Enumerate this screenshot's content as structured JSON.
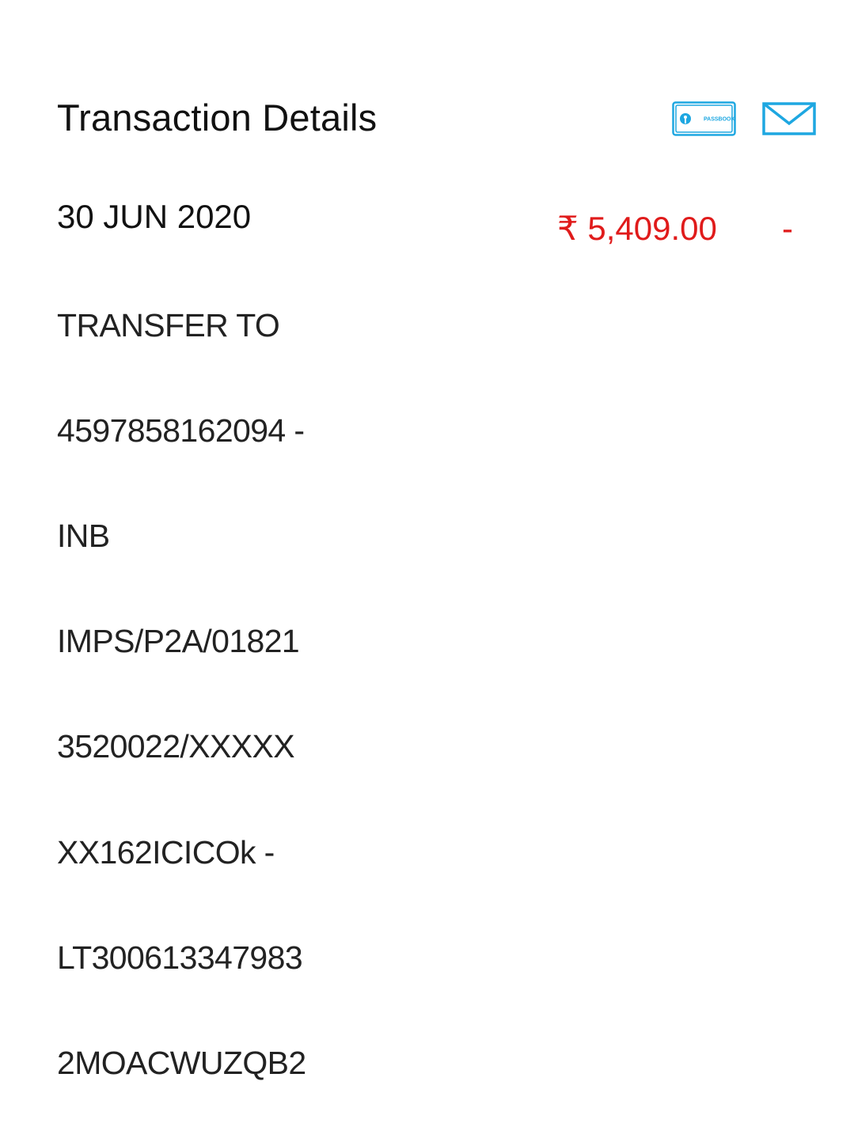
{
  "header": {
    "title": "Transaction Details",
    "passbook_icon_text": "PASSBOOK"
  },
  "transaction": {
    "date": "30 JUN 2020",
    "description_lines": [
      "TRANSFER TO",
      "4597858162094 -",
      "INB",
      "IMPS/P2A/01821",
      "3520022/XXXXX",
      "XX162ICICOk -",
      "LT300613347983",
      "2MOACWUZQB2"
    ],
    "amount": "₹ 5,409.00",
    "type_sign": "-"
  },
  "colors": {
    "debit": "#e01b1b",
    "icon_accent": "#1ea7e1"
  },
  "icons": {
    "passbook": "passbook-icon",
    "mail": "mail-icon"
  }
}
